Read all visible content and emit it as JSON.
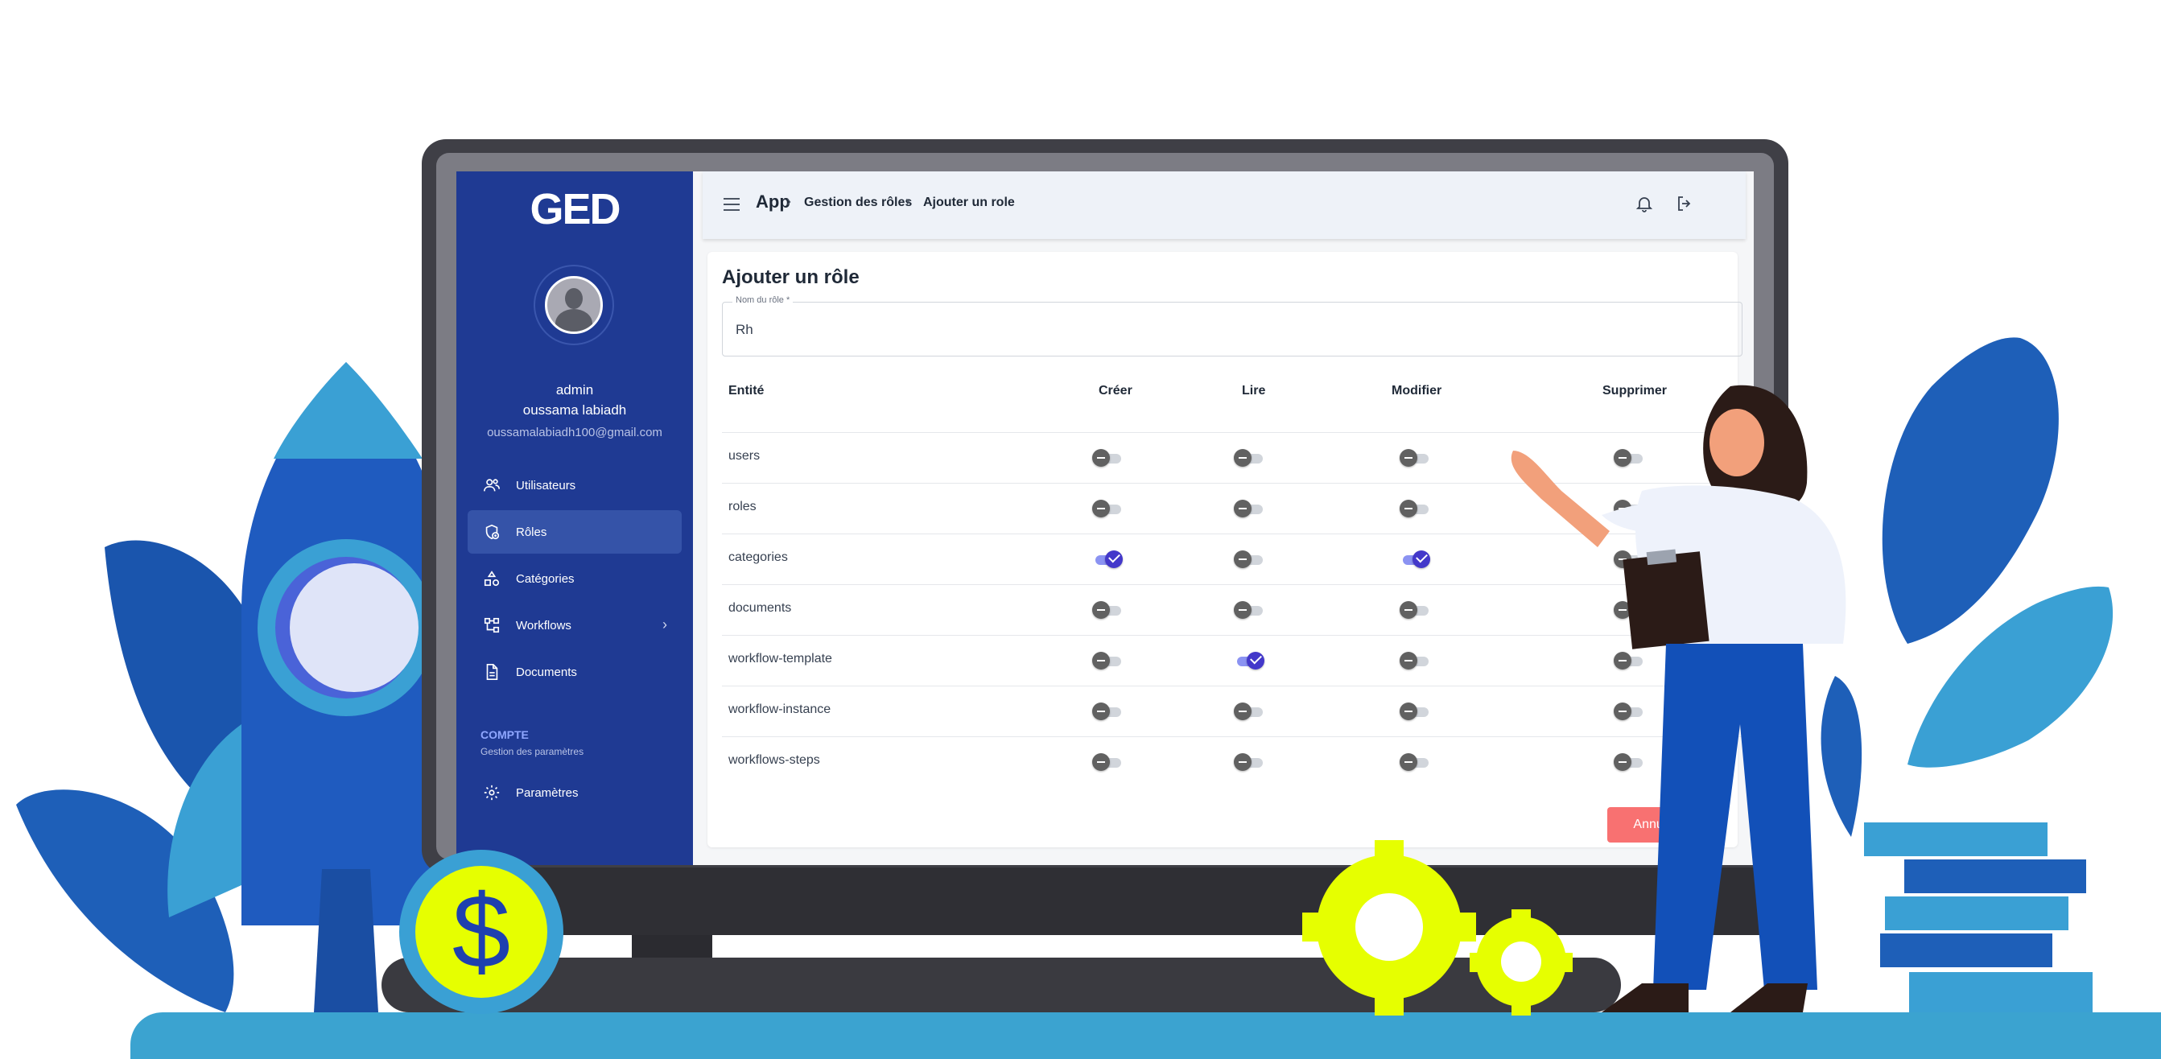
{
  "app": {
    "logo": "GED",
    "title": "Ajouter un rôle"
  },
  "user": {
    "role": "admin",
    "name": "oussama labiadh",
    "email": "oussamalabiadh100@gmail.com"
  },
  "sidebar": {
    "items": [
      {
        "label": "Utilisateurs",
        "icon": "users-icon",
        "active": false
      },
      {
        "label": "Rôles",
        "icon": "shield-role-icon",
        "active": true
      },
      {
        "label": "Catégories",
        "icon": "shapes-icon",
        "active": false
      },
      {
        "label": "Workflows",
        "icon": "flow-icon",
        "active": false,
        "has_chevron": true
      },
      {
        "label": "Documents",
        "icon": "document-icon",
        "active": false
      }
    ],
    "section_title": "COMPTE",
    "section_subtitle": "Gestion des paramètres",
    "settings_label": "Paramètres"
  },
  "header": {
    "breadcrumb": [
      "App",
      "Gestion des rôles",
      "Ajouter un role"
    ],
    "icons": [
      "bell-icon",
      "logout-icon"
    ]
  },
  "form": {
    "name_label": "Nom du rôle *",
    "name_value": "Rh"
  },
  "table": {
    "headers": [
      "Entité",
      "Créer",
      "Lire",
      "Modifier",
      "Supprimer"
    ],
    "rows": [
      {
        "entity": "users",
        "perms": [
          false,
          false,
          false,
          false
        ]
      },
      {
        "entity": "roles",
        "perms": [
          false,
          false,
          false,
          false
        ]
      },
      {
        "entity": "categories",
        "perms": [
          true,
          false,
          true,
          false
        ]
      },
      {
        "entity": "documents",
        "perms": [
          false,
          false,
          false,
          false
        ]
      },
      {
        "entity": "workflow-template",
        "perms": [
          false,
          true,
          false,
          false
        ]
      },
      {
        "entity": "workflow-instance",
        "perms": [
          false,
          false,
          false,
          false
        ]
      },
      {
        "entity": "workflows-steps",
        "perms": [
          false,
          false,
          false,
          false
        ]
      }
    ]
  },
  "actions": {
    "cancel_label": "Annuler"
  },
  "decor": {
    "currency_symbol": "$"
  },
  "colors": {
    "sidebar": "#1f3a93",
    "accent": "#4338ca",
    "cancel": "#f87171",
    "ground": "#3ba3d0"
  }
}
